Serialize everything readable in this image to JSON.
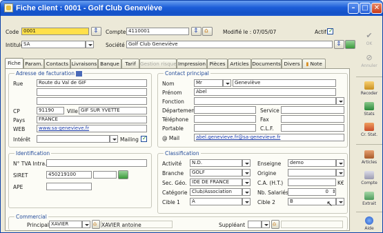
{
  "window": {
    "title": "Fiche client : 0001 - Golf Club Geneviève"
  },
  "header": {
    "code_label": "Code",
    "code_value": "0001",
    "compte_label": "Compte",
    "compte_value": "4110001",
    "modifie_label": "Modifié le : 07/05/07",
    "actif_label": "Actif",
    "intitule_label": "Intitulé",
    "intitule_value": "SA",
    "societe_label": "Société",
    "societe_value": "Golf Club Geneviève"
  },
  "tabs": [
    "Fiche",
    "Param.",
    "Contacts",
    "Livraisons",
    "Banque",
    "Tarif",
    "Gestion risque",
    "Impression",
    "Pièces",
    "Articles",
    "Documents",
    "Divers",
    "Note"
  ],
  "facturation": {
    "title": "Adresse de facturation",
    "rue_label": "Rue",
    "rue_value": "Route du Val de GIF",
    "cp_label": "CP",
    "cp_value": "91190",
    "ville_label": "Ville",
    "ville_value": "GIF SUR YVETTE",
    "pays_label": "Pays",
    "pays_value": "FRANCE",
    "web_label": "WEB",
    "web_value": "www.sa-genevieve.fr",
    "interet_label": "Intérêt",
    "mailing_label": "Mailing"
  },
  "contact": {
    "title": "Contact principal",
    "nom_label": "Nom",
    "civilite": "Mr",
    "nom_value": "Geneviève",
    "prenom_label": "Prénom",
    "prenom_value": "Abel",
    "fonction_label": "Fonction",
    "departement_label": "Département",
    "service_label": "Service",
    "telephone_label": "Téléphone",
    "fax_label": "Fax",
    "portable_label": "Portable",
    "clf_label": "C.L.F.",
    "mail_label": "@ Mail",
    "mail_value": "abel.genevieve.fr@sa-genevieve.fr"
  },
  "identification": {
    "title": "Identification",
    "tva_label": "N° TVA Intra.",
    "siret_label": "SIRET",
    "siret_value": "450219100",
    "ape_label": "APE"
  },
  "classification": {
    "title": "Classification",
    "activite_label": "Activité",
    "activite_value": "N.D.",
    "enseigne_label": "Enseigne",
    "enseigne_value": "demo",
    "branche_label": "Branche",
    "branche_value": "GOLF",
    "origine_label": "Origine",
    "secgeo_label": "Sec. Géo.",
    "secgeo_value": "IDE DE FRANCE",
    "ca_label": "C.A. (H.T.)",
    "ca_unit": "K€",
    "categorie_label": "Catégorie",
    "categorie_value": "Club/Association",
    "salaries_label": "Nb. Salariés",
    "salaries_value": "0",
    "cible1_label": "Cible 1",
    "cible1_value": "A",
    "cible2_label": "Cible 2",
    "cible2_value": "B"
  },
  "commercial": {
    "title": "Commercial",
    "principal_label": "Principal",
    "principal_value": "XAVIER",
    "principal_name": "XAVIER antoine",
    "suppleant_label": "Suppléant"
  },
  "sidebar": [
    {
      "label": "OK",
      "icon": "check-icon"
    },
    {
      "label": "Annuler",
      "icon": "cancel-icon"
    },
    {
      "label": "Recoder",
      "icon": "recode-icon"
    },
    {
      "label": "Stats",
      "icon": "stats-icon"
    },
    {
      "label": "Cr. Stat.",
      "icon": "create-stat-icon"
    },
    {
      "label": "Articles",
      "icon": "articles-icon"
    },
    {
      "label": "Compte",
      "icon": "account-icon"
    },
    {
      "label": "Extrait",
      "icon": "extract-icon"
    },
    {
      "label": "Aide",
      "icon": "help-icon"
    }
  ]
}
